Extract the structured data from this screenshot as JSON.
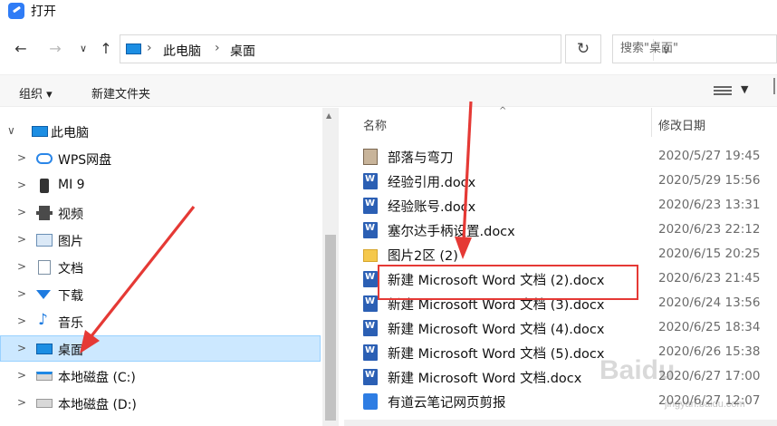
{
  "window": {
    "title": "打开",
    "app_icon": "document-app-icon"
  },
  "navigation": {
    "back_label": "←",
    "forward_label": "→",
    "recent_label": "∨",
    "up_label": "↑",
    "breadcrumb": [
      "此电脑",
      "桌面"
    ],
    "refresh_label": "↻",
    "search_placeholder": "搜索\"桌面\""
  },
  "toolbar": {
    "organize_label": "组织 ▾",
    "new_folder_label": "新建文件夹",
    "view_dropdown_label": "▼"
  },
  "sidebar": {
    "items": [
      {
        "label": "此电脑",
        "icon": "pc-icon",
        "expanded": true,
        "chevron": "∨"
      },
      {
        "label": "WPS网盘",
        "icon": "cloud-icon",
        "chevron": ">"
      },
      {
        "label": "MI 9",
        "icon": "phone-icon",
        "chevron": ">"
      },
      {
        "label": "视频",
        "icon": "video-icon",
        "chevron": ">"
      },
      {
        "label": "图片",
        "icon": "pictures-icon",
        "chevron": ">"
      },
      {
        "label": "文档",
        "icon": "documents-icon",
        "chevron": ">"
      },
      {
        "label": "下载",
        "icon": "download-icon",
        "chevron": ">"
      },
      {
        "label": "音乐",
        "icon": "music-icon",
        "chevron": ">"
      },
      {
        "label": "桌面",
        "icon": "desktop-icon",
        "selected": true,
        "chevron": ">"
      },
      {
        "label": "本地磁盘 (C:)",
        "icon": "system-disk-icon",
        "chevron": ">"
      },
      {
        "label": "本地磁盘 (D:)",
        "icon": "disk-icon",
        "chevron": ">"
      }
    ]
  },
  "file_list": {
    "columns": {
      "name": "名称",
      "modified": "修改日期"
    },
    "rows": [
      {
        "name": "部落与弯刀",
        "modified": "2020/5/27 19:45",
        "icon": "shortcut-icon"
      },
      {
        "name": "经验引用.docx",
        "modified": "2020/5/29 15:56",
        "icon": "word-icon"
      },
      {
        "name": "经验账号.docx",
        "modified": "2020/6/23 13:31",
        "icon": "word-icon"
      },
      {
        "name": "塞尔达手柄设置.docx",
        "modified": "2020/6/23 22:12",
        "icon": "word-icon"
      },
      {
        "name": "图片2区 (2)",
        "modified": "2020/6/15 20:25",
        "icon": "folder-icon"
      },
      {
        "name": "新建 Microsoft Word 文档 (2).docx",
        "modified": "2020/6/23 21:45",
        "icon": "word-icon",
        "highlighted": true
      },
      {
        "name": "新建 Microsoft Word 文档 (3).docx",
        "modified": "2020/6/24 13:56",
        "icon": "word-icon"
      },
      {
        "name": "新建 Microsoft Word 文档 (4).docx",
        "modified": "2020/6/25 18:34",
        "icon": "word-icon"
      },
      {
        "name": "新建 Microsoft Word 文档 (5).docx",
        "modified": "2020/6/26 15:38",
        "icon": "word-icon"
      },
      {
        "name": "新建 Microsoft Word 文档.docx",
        "modified": "2020/6/27 17:00",
        "icon": "word-icon"
      },
      {
        "name": "有道云笔记网页剪报",
        "modified": "2020/6/27 12:07",
        "icon": "youdao-icon"
      }
    ]
  },
  "annotations": {
    "accent_color": "#e53935",
    "selection_color": "#cce8ff"
  },
  "watermark": {
    "text": "Baidu",
    "sub": "jingyan.baidu.com"
  }
}
